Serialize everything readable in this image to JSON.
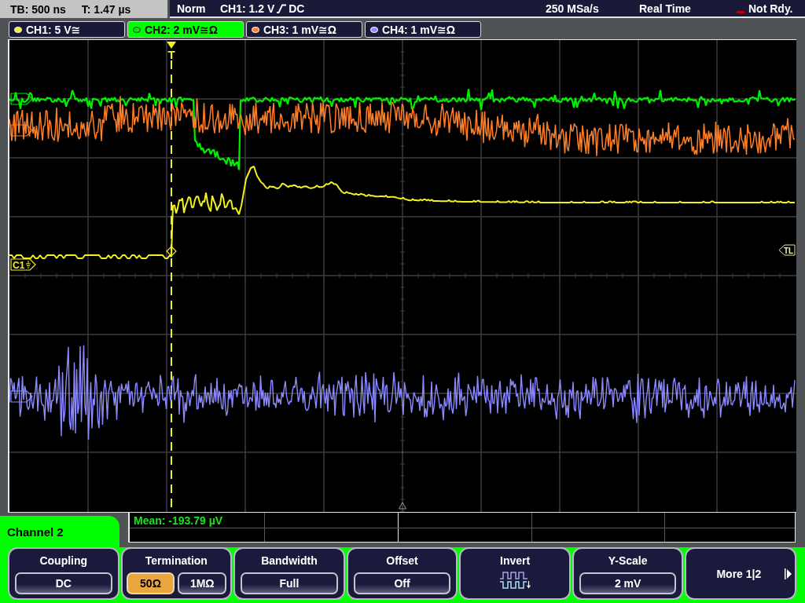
{
  "status_bar": {
    "timebase": "TB: 500 ns",
    "trigger_time": "T: 1.47 µs",
    "trigger_mode": "Norm",
    "trigger_source": "CH1: 1.2 V",
    "trigger_coupling": "DC",
    "sample_rate": "250 MSa/s",
    "acquisition_mode": "Real Time",
    "acquisition_state": "Not Rdy."
  },
  "channel_tabs": [
    {
      "label": "CH1: 5 V≅",
      "color": "#f4f020",
      "selected": false
    },
    {
      "label": "CH2: 2 mV≅Ω",
      "color": "#00ee00",
      "selected": true
    },
    {
      "label": "CH3: 1 mV≅Ω",
      "color": "#ff7f27",
      "selected": false
    },
    {
      "label": "CH4: 1 mV≅Ω",
      "color": "#8c8aff",
      "selected": false
    }
  ],
  "waveform_display": {
    "trigger_marker": {
      "label": "T"
    },
    "traces": [
      {
        "kind": "step",
        "color": "#f4f020"
      },
      {
        "kind": "dip",
        "color": "#00ee00"
      },
      {
        "kind": "drift",
        "color": "#ff7f27"
      },
      {
        "kind": "burst",
        "color": "#8c8aff"
      }
    ],
    "markers": [
      {
        "label": "C1",
        "color": "#f4f020"
      },
      {
        "color": "#00ee00"
      },
      {
        "color": "#ff7f27"
      },
      {
        "color": "#8c8aff"
      }
    ],
    "trigger_level_marker": {
      "label": "TL"
    }
  },
  "measurements": {
    "mean": "Mean: -193.79 µV"
  },
  "menu": {
    "title": "Channel 2",
    "softkeys": [
      {
        "kind": "value",
        "label": "Coupling",
        "value": "DC"
      },
      {
        "kind": "options",
        "label": "Termination",
        "options": [
          {
            "label": "50Ω",
            "selected": true
          },
          {
            "label": "1MΩ",
            "selected": false
          }
        ]
      },
      {
        "kind": "value",
        "label": "Bandwidth",
        "value": "Full"
      },
      {
        "kind": "value",
        "label": "Offset",
        "value": "Off"
      },
      {
        "kind": "icon",
        "label": "Invert"
      },
      {
        "kind": "value",
        "label": "Y-Scale",
        "value": "2 mV"
      },
      {
        "kind": "next",
        "label": "More 1|2"
      }
    ]
  }
}
